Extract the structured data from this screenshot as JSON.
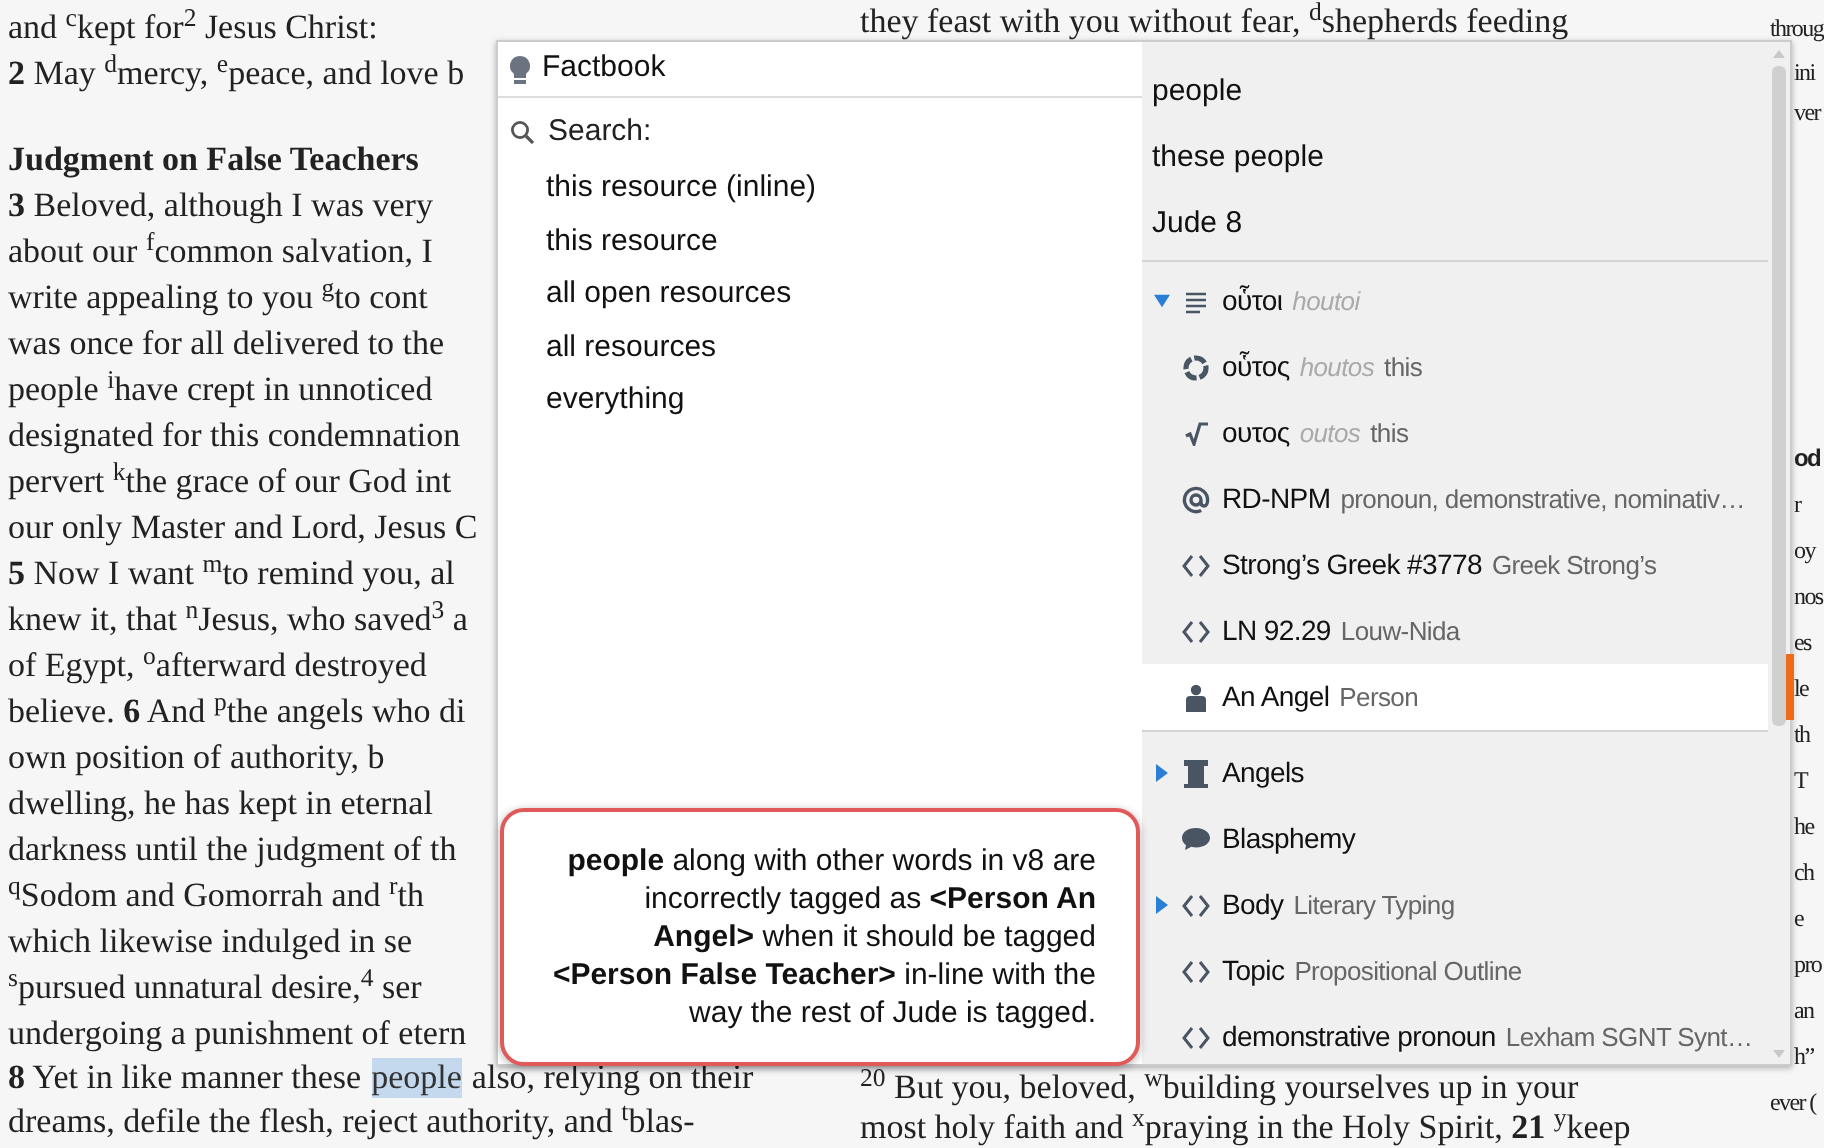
{
  "page": {
    "left_column": {
      "lines_top": [
        "and $^{c}$kept for$^{2}$ Jesus Christ:",
        "**2** May $^{d}$mercy, $^{e}$peace, and love b"
      ],
      "heading": "Judgment on False Teachers",
      "lines": [
        "**3** Beloved, although I was very",
        "about our $^{f}$common salvation, I",
        "write appealing to you $^{g}$to cont",
        "was once for all delivered to the",
        "people $^{i}$have crept in unnoticed",
        "designated for this condemnation",
        "pervert $^{k}$the grace of our God int",
        "our only Master and Lord, Jesus C",
        "**5** Now I want $^{m}$to remind you, al",
        "knew it, that $^{n}$Jesus, who saved$^{3}$ a",
        "of Egypt, $^{o}$afterward destroyed",
        "believe. **6** And $^{p}$the angels who di",
        "own position of authority, b",
        "dwelling, he has kept in eternal",
        "darkness until the judgment of th",
        "$^{q}$Sodom and Gomorrah and $^{r}$th",
        "which likewise indulged in se",
        "$^{s}$pursued unnatural desire,$^{4}$ ser",
        "undergoing a punishment of etern"
      ],
      "last_line": {
        "before": "**8** Yet in like manner these",
        "selected_word": "people",
        "after": "also, relying on their"
      },
      "final_line": "dreams, defile the flesh, reject authority, and $^{t}$blas-"
    },
    "middle_column": {
      "top_line": "they feast with you without fear, $^{d}$shepherds feeding",
      "bottom_lines": [
        "$^{20}$ But you, beloved, $^{w}$building yourselves up in your",
        "most holy faith and $^{x}$praying in the Holy Spirit, **21** $^{y}$keep"
      ]
    },
    "right_column": {
      "top_lines": [
        "throug",
        "ini",
        "ver"
      ],
      "heading": "od",
      "lines": [
        "r",
        "oy",
        "nos",
        "es",
        "le",
        "th",
        "T",
        "he",
        "ch",
        "e",
        "pro",
        "an",
        "h”",
        "ever ("
      ]
    }
  },
  "popup": {
    "title": "Factbook",
    "search_label": "Search:",
    "search_options": [
      "this resource (inline)",
      "this resource",
      "all open resources",
      "all resources",
      "everything"
    ],
    "terms": [
      "people",
      "these people",
      "Jude 8"
    ],
    "entries": [
      {
        "kind": "word",
        "label": "οὗτοι",
        "translit": "houtoi",
        "expandable": true,
        "expanded": true,
        "selected": false
      },
      {
        "kind": "lemma",
        "label": "οὗτος",
        "translit": "houtos",
        "gloss": "this",
        "expandable": false,
        "selected": false
      },
      {
        "kind": "root",
        "label": "ουτος",
        "translit": "outos",
        "gloss": "this",
        "expandable": false,
        "selected": false
      },
      {
        "kind": "morph",
        "label": "RD-NPM",
        "gloss": "pronoun, demonstrative, nominativ…",
        "expandable": false,
        "selected": false
      },
      {
        "kind": "reference",
        "label": "Strong’s Greek #3778",
        "gloss": "Greek Strong’s",
        "expandable": false,
        "selected": false
      },
      {
        "kind": "reference",
        "label": "LN 92.29",
        "gloss": "Louw-Nida",
        "expandable": false,
        "selected": false
      },
      {
        "kind": "person",
        "label": "An Angel",
        "gloss": "Person",
        "expandable": false,
        "selected": true
      }
    ],
    "topics": [
      {
        "kind": "group",
        "label": "Angels",
        "expandable": true,
        "expanded": false
      },
      {
        "kind": "topic",
        "label": "Blasphemy",
        "expandable": false
      },
      {
        "kind": "reference",
        "label": "Body",
        "gloss": "Literary Typing",
        "expandable": true,
        "expanded": false
      },
      {
        "kind": "reference",
        "label": "Topic",
        "gloss": "Propositional Outline",
        "expandable": false
      },
      {
        "kind": "reference",
        "label": "demonstrative pronoun",
        "gloss": "Lexham SGNT Synt…",
        "expandable": false
      }
    ]
  },
  "callout": {
    "text": "**people** along with other words in v8 are incorrectly tagged as **<Person An Angel>** when it should be tagged **<Person False Teacher>** in-line with the way the rest of Jude is tagged."
  }
}
